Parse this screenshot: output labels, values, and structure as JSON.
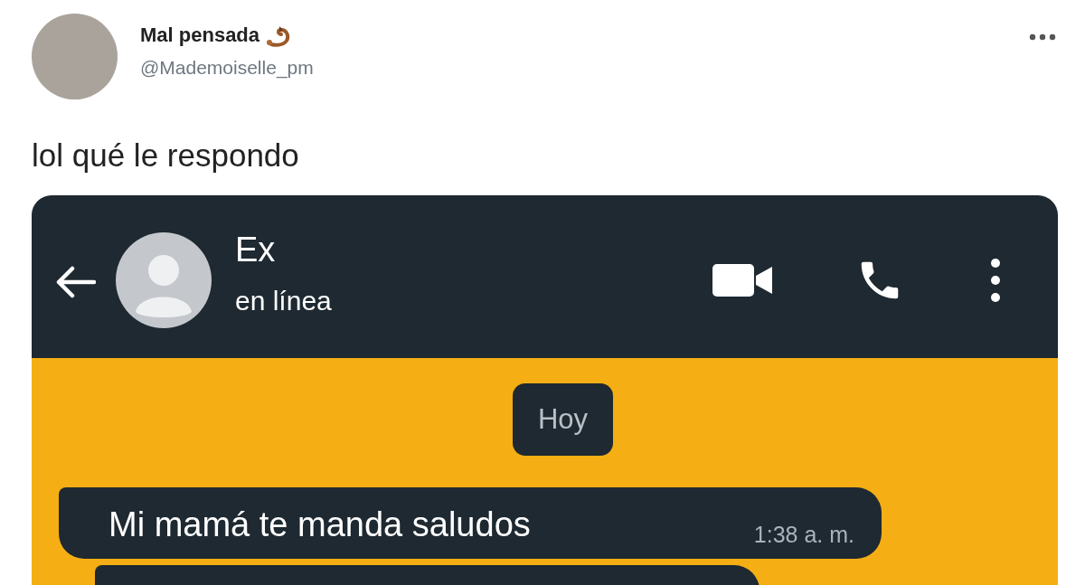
{
  "tweet": {
    "display_name": "Mal pensada",
    "handle": "@Mademoiselle_pm",
    "text": "lol qué le respondo"
  },
  "chat": {
    "contact_name": "Ex",
    "status": "en línea",
    "date_badge": "Hoy",
    "messages": [
      {
        "text": "Mi mamá te manda saludos",
        "time": "1:38 a. m."
      }
    ]
  }
}
